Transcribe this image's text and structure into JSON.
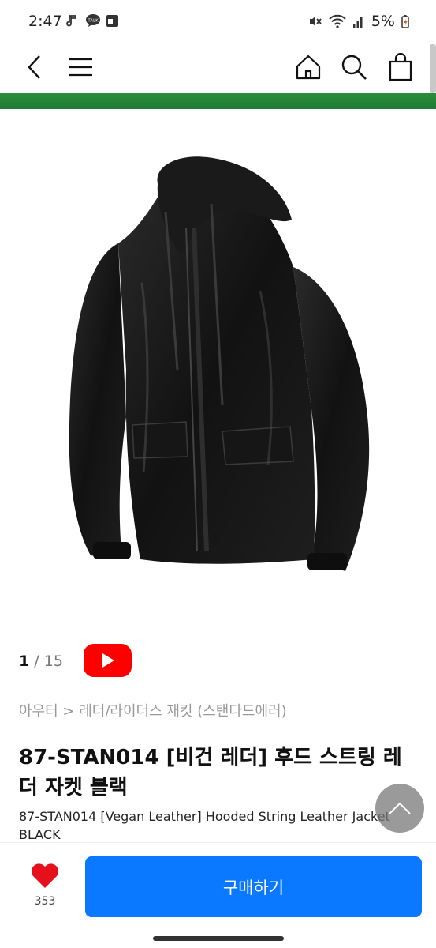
{
  "status_bar": {
    "time": "2:47",
    "battery": "5%",
    "icons": [
      "music-note-icon",
      "talk-icon",
      "app-icon",
      "mute-icon",
      "wifi-icon",
      "signal-icon",
      "battery-icon"
    ]
  },
  "nav": {
    "icons": [
      "back-icon",
      "menu-icon",
      "home-icon",
      "search-icon",
      "cart-icon"
    ]
  },
  "gallery": {
    "current": "1",
    "separator": "/",
    "total": "15"
  },
  "breadcrumb": "아우터 > 레더/라이더스 재킷 (스탠다드에러)",
  "product": {
    "title_ko": "87-STAN014 [비건 레더] 후드 스트링 레더 자켓 블랙",
    "title_en": "87-STAN014 [Vegan Leather] Hooded String Leather Jacket BLACK"
  },
  "bottom_bar": {
    "like_count": "353",
    "buy_label": "구매하기"
  },
  "colors": {
    "accent": "#0a78ff",
    "like": "#e6101c",
    "video": "#ff0000",
    "banner": "#1f7a33"
  }
}
